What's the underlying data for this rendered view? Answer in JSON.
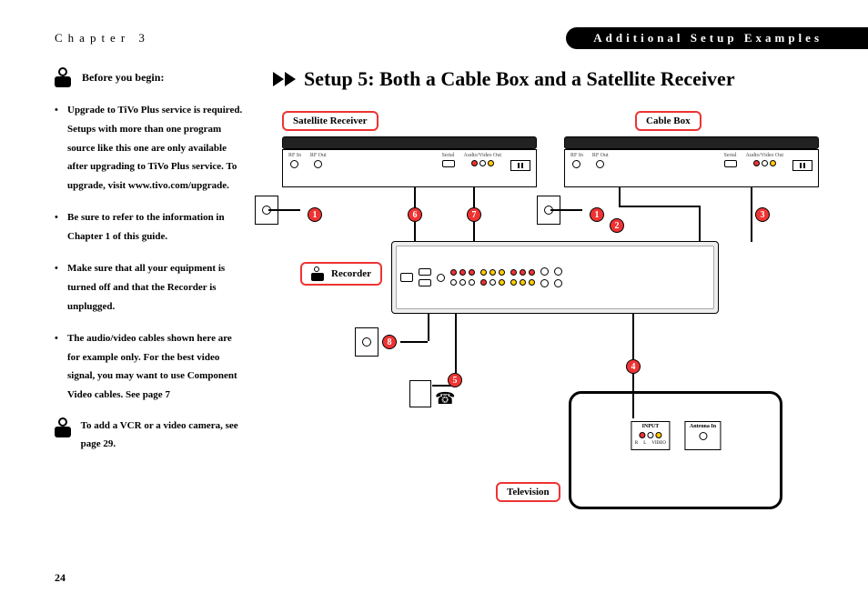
{
  "header": {
    "chapter": "Chapter 3",
    "right": "Additional Setup Examples"
  },
  "sidebar": {
    "before_begin": "Before you begin:",
    "bullets": [
      "Upgrade to TiVo Plus service is required. Setups with more than one program source like this one are only available after upgrading to TiVo Plus service. To upgrade, visit www.tivo.com/upgrade.",
      "Be sure to refer to the information in Chapter 1 of this guide.",
      "Make sure that all your equipment is turned off and that the Recorder is unplugged.",
      "The audio/video cables shown here are for example only. For the best video signal, you may want to use Component Video cables. See page 7"
    ],
    "add_vcr": "To add a VCR or a video camera, see page 29."
  },
  "main": {
    "title": "Setup 5: Both a Cable Box and a Satellite Receiver"
  },
  "diagram": {
    "labels": {
      "satellite": "Satellite Receiver",
      "cablebox": "Cable Box",
      "recorder": "Recorder",
      "television": "Television"
    },
    "ports": {
      "rf_in": "RF In",
      "rf_out": "RF Out",
      "serial": "Serial",
      "av_out": "Audio/Video Out",
      "input": "INPUT",
      "antenna": "Antenna In",
      "r": "R",
      "l": "L",
      "video": "VIDEO"
    },
    "badges": [
      "1",
      "2",
      "3",
      "4",
      "5",
      "6",
      "7",
      "8"
    ]
  },
  "page_number": "24"
}
